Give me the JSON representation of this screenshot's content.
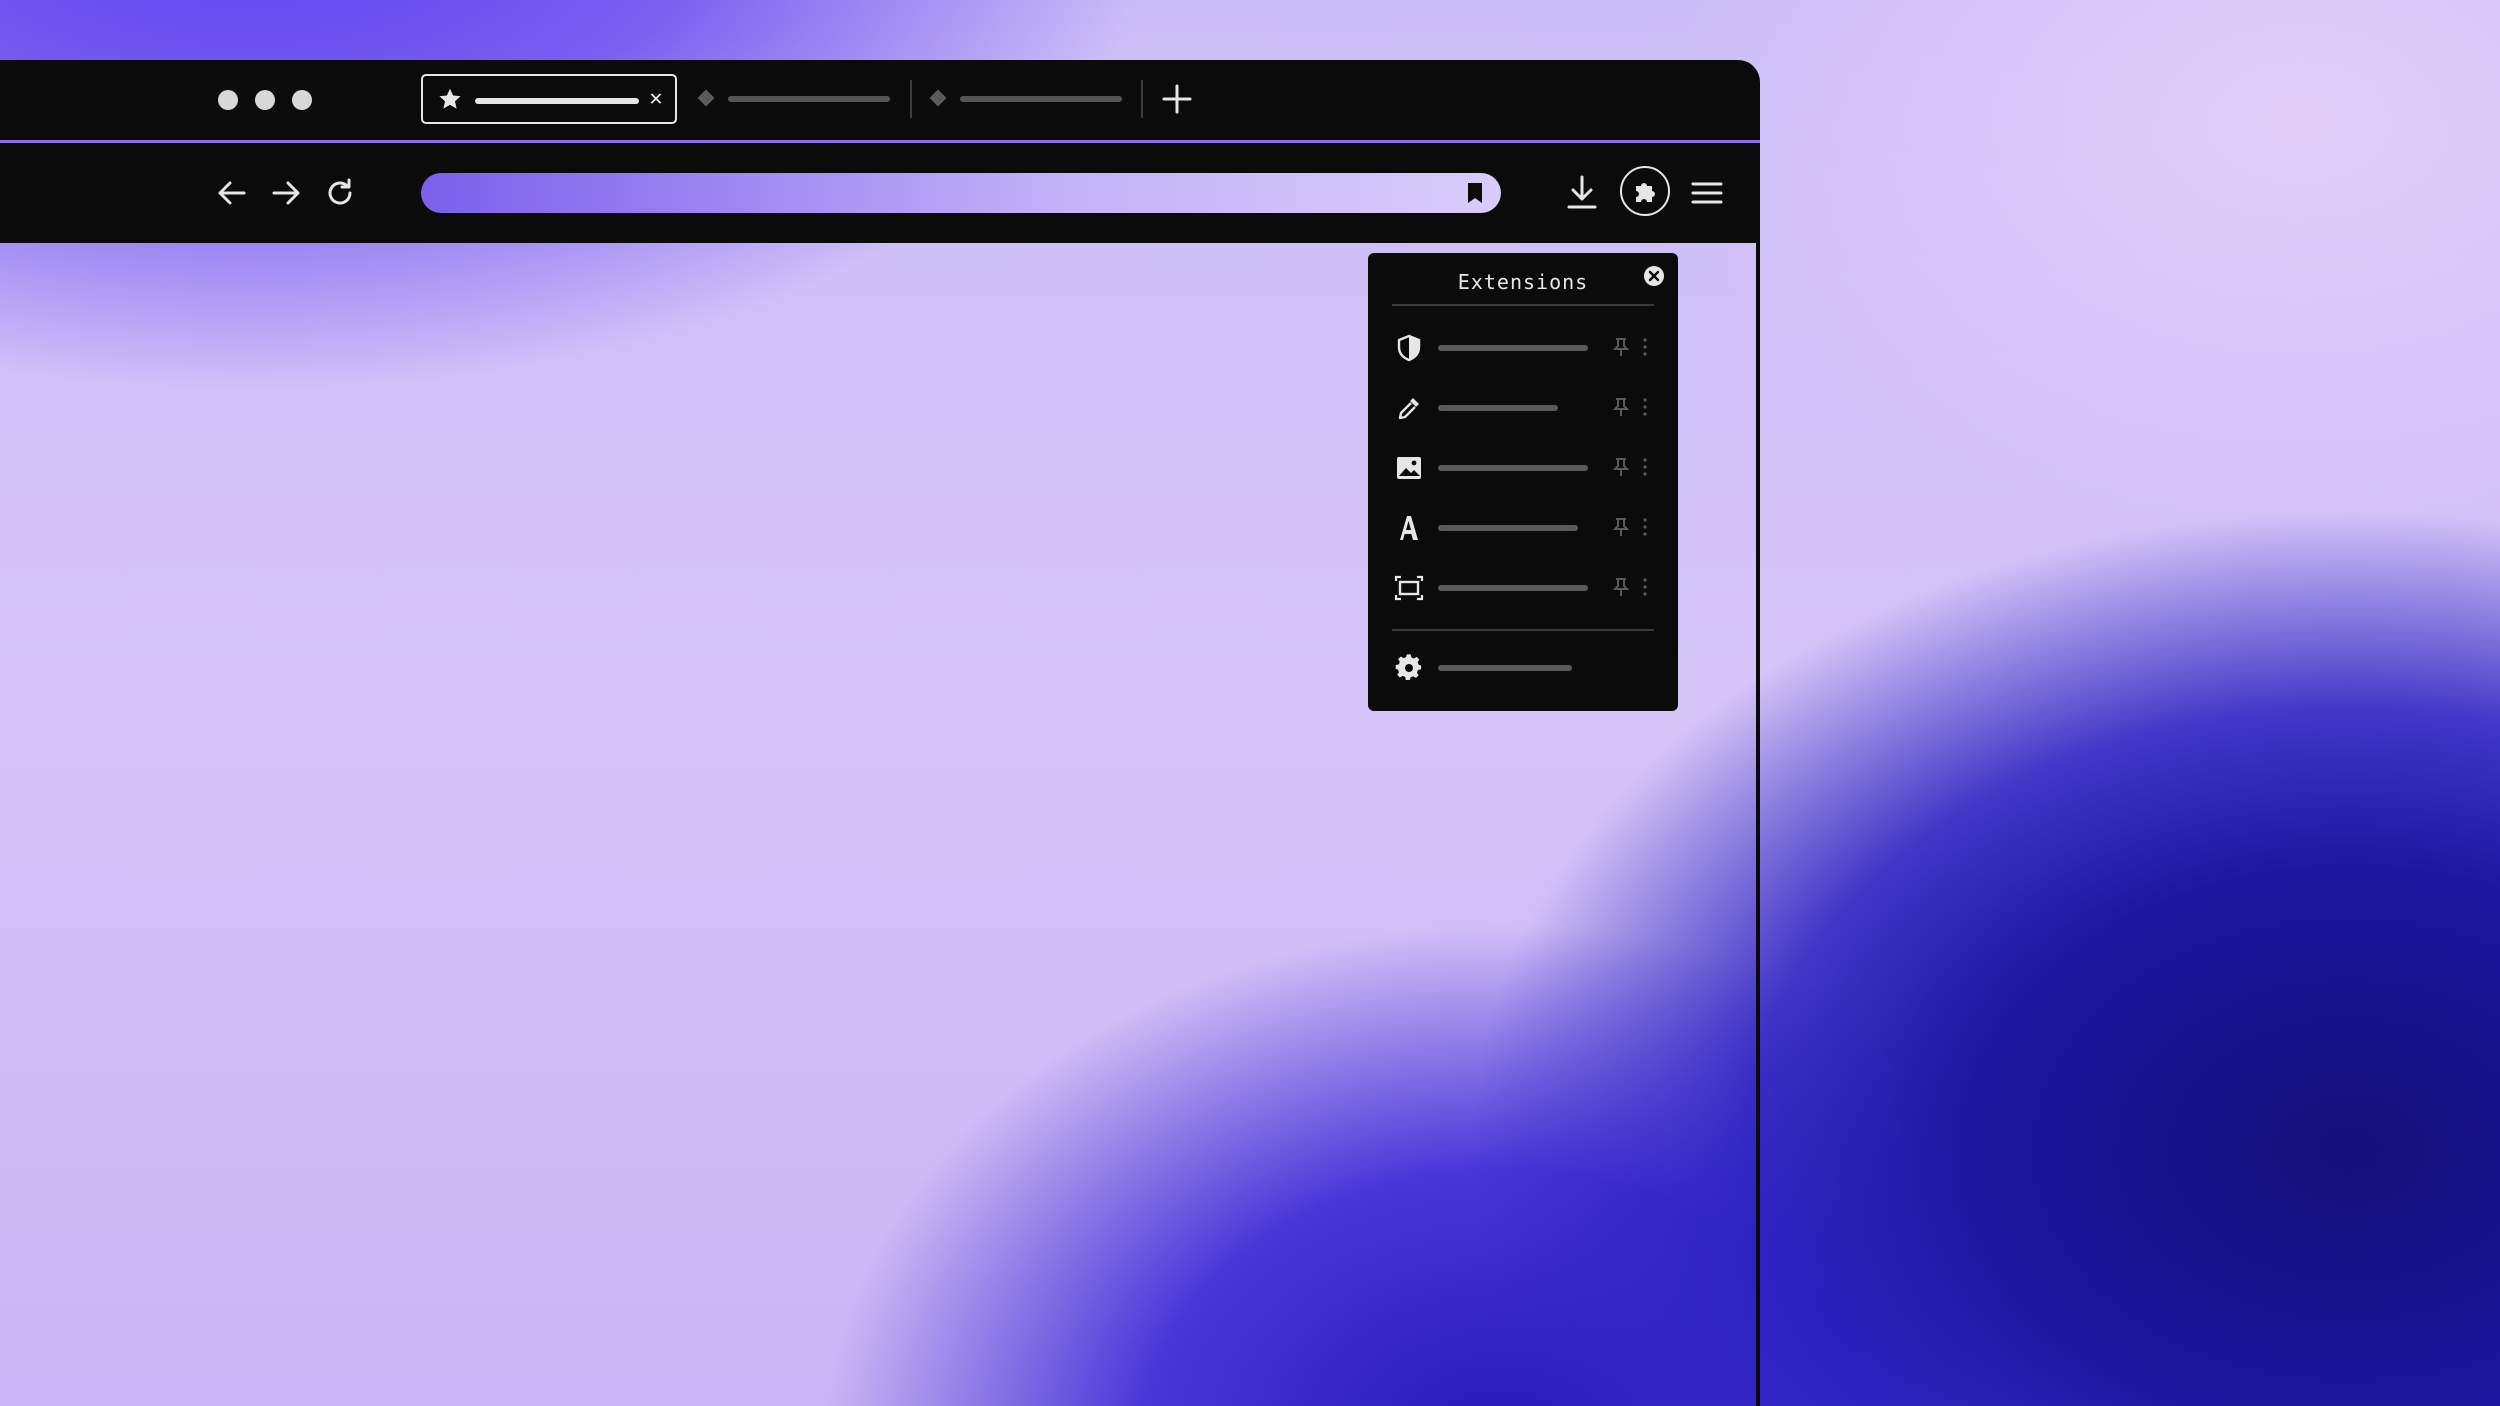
{
  "extensions_panel": {
    "title": "Extensions",
    "items": [
      {
        "icon": "shield-icon"
      },
      {
        "icon": "eyedropper-icon"
      },
      {
        "icon": "image-icon"
      },
      {
        "icon": "font-icon"
      },
      {
        "icon": "screenshot-icon"
      }
    ],
    "footer_icon": "gear-icon"
  },
  "colors": {
    "chrome": "#0b0b0b",
    "accent": "#8a70f0",
    "foreground": "#e6e6e6"
  }
}
